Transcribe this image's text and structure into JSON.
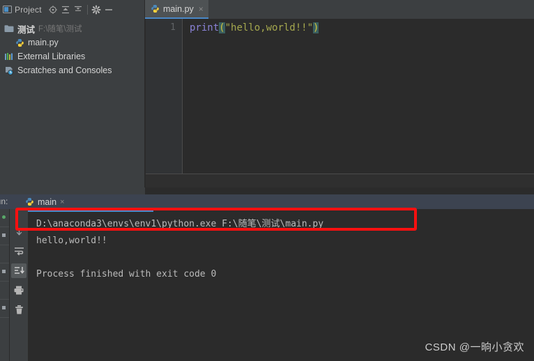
{
  "project_panel": {
    "title": "Project",
    "toolbar_icons": [
      {
        "name": "locate-target-icon",
        "glyph": "⊕"
      },
      {
        "name": "expand-all-icon",
        "glyph": "≡"
      },
      {
        "name": "collapse-all-icon",
        "glyph": "≡"
      },
      {
        "name": "settings-gear-icon",
        "glyph": "⚙"
      },
      {
        "name": "hide-panel-icon",
        "glyph": "─"
      }
    ],
    "tree": [
      {
        "name": "project-root",
        "label": "测试",
        "sub": "F:\\随笔\\测试",
        "icon": "folder-icon",
        "indent": 0,
        "bold": true
      },
      {
        "name": "file-main-py",
        "label": "main.py",
        "sub": "",
        "icon": "python-file-icon",
        "indent": 1,
        "bold": false
      },
      {
        "name": "external-libraries",
        "label": "External Libraries",
        "sub": "",
        "icon": "libraries-icon",
        "indent": 0,
        "bold": false
      },
      {
        "name": "scratches-and-consoles",
        "label": "Scratches and Consoles",
        "sub": "",
        "icon": "scratches-icon",
        "indent": 0,
        "bold": false
      }
    ]
  },
  "editor": {
    "tab": {
      "label": "main.py",
      "icon": "python-file-icon",
      "close": "×"
    },
    "line_number": "1",
    "code": {
      "keyword": "print",
      "open_paren": "(",
      "string": "\"hello,world!!\"",
      "close_paren": ")"
    }
  },
  "run_window": {
    "label": "Run:",
    "tab_label": "main",
    "tab_close": "×",
    "gutter_icons": [
      {
        "name": "rerun-icon",
        "glyph": "▶"
      },
      {
        "name": "scroll-down-icon",
        "glyph": "↓"
      },
      {
        "name": "soft-wrap-icon",
        "glyph": "↵"
      },
      {
        "name": "scroll-to-end-icon",
        "glyph": "⬇"
      },
      {
        "name": "print-icon",
        "glyph": "⎙"
      },
      {
        "name": "clear-all-icon",
        "glyph": "Ὕ1"
      }
    ],
    "console_lines": [
      "D:\\anaconda3\\envs\\env1\\python.exe F:\\随笔\\测试\\main.py",
      "hello,world!!",
      "",
      "Process finished with exit code 0"
    ]
  },
  "annotation": {
    "color": "#fb1010",
    "target_line": "D:\\anaconda3\\envs\\env1\\python.exe F:\\随笔\\测试\\main.py"
  },
  "watermark": {
    "text": "CSDN @一晌小贪欢"
  },
  "colors": {
    "panel_bg": "#3c3f41",
    "editor_bg": "#2b2b2b",
    "accent_blue": "#4a88c7",
    "annotation_red": "#fb1010",
    "keyword_purple": "#8a82d6",
    "string_olive": "#a5a84e",
    "paren_yellow": "#d3c53a"
  }
}
